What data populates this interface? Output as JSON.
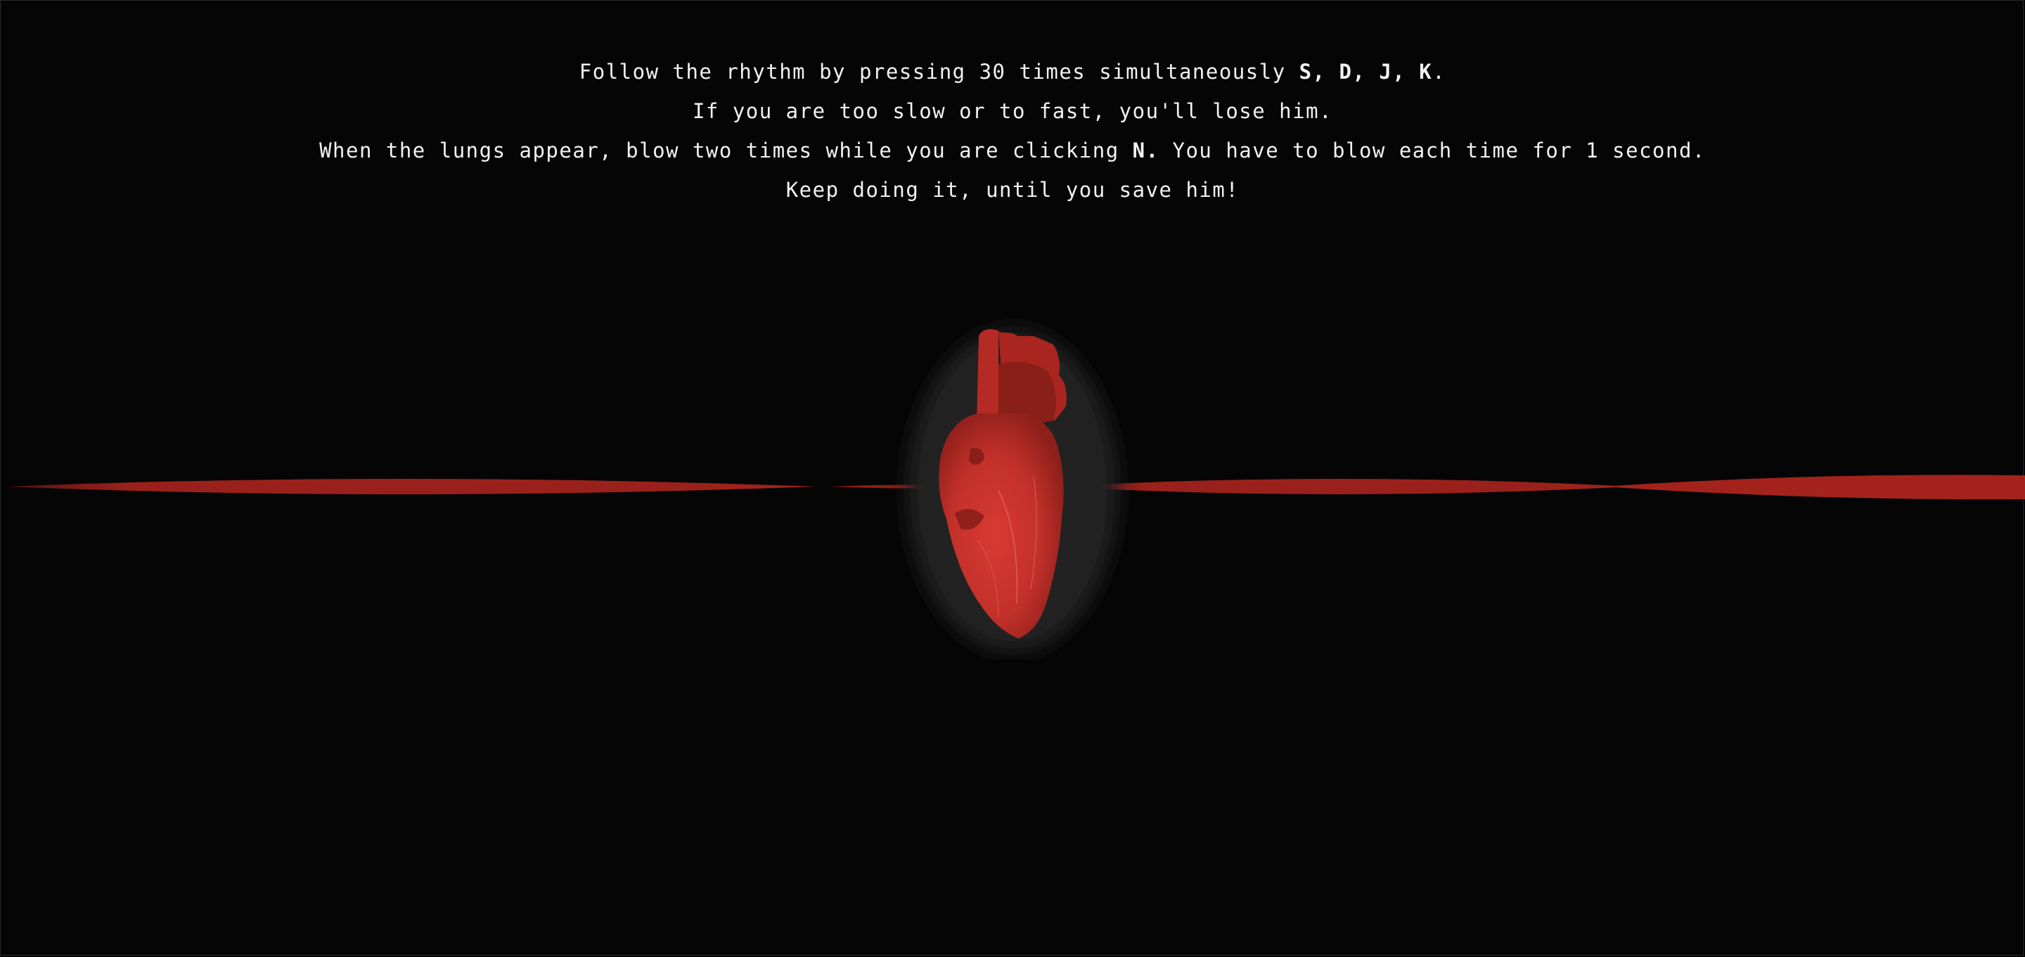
{
  "instructions": {
    "line1_before": "Follow the rhythm by pressing 30 times simultaneously ",
    "line1_keys": "S, D, J, K",
    "line1_after": ".",
    "line2": "If you are too slow or to fast, you'll lose him.",
    "line3_before": "When the lungs appear, blow two times while you are clicking ",
    "line3_key": "N.",
    "line3_after": " You have to blow each time for 1 second.",
    "line4": "Keep doing it, until you save him!"
  },
  "colors": {
    "background": "#050505",
    "text": "#f2f2f2",
    "pulse": "#8e1c17",
    "heart": "#c8322c",
    "heart_dark": "#7d1a16",
    "heart_glow": "#2a2a2a"
  },
  "icons": {
    "heart": "anatomical-heart-icon",
    "pulse": "heartbeat-line-icon"
  }
}
